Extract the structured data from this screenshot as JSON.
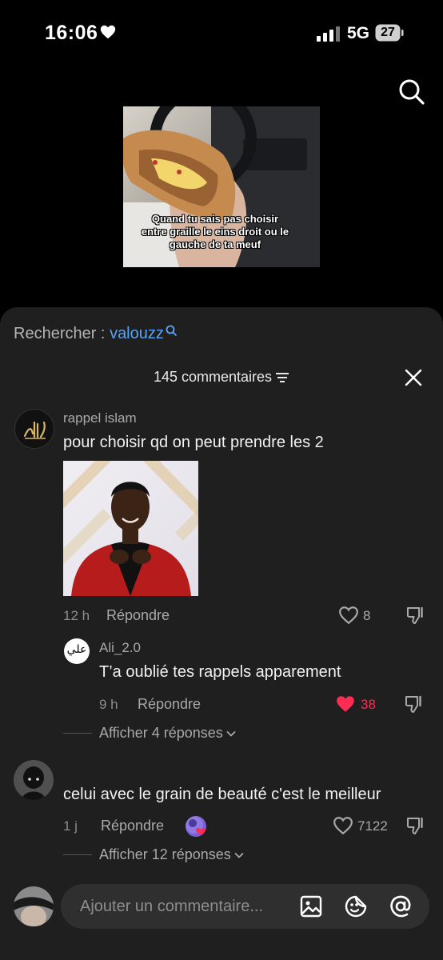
{
  "status": {
    "time": "16:06",
    "network": "5G",
    "battery": "27"
  },
  "video": {
    "caption": "Quand tu sais pas choisir entre graille le eins droit ou le gauche de ta meuf"
  },
  "search": {
    "label": "Rechercher : ",
    "term": "valouzz"
  },
  "header": {
    "comment_count": "145 commentaires"
  },
  "comments": [
    {
      "username": "rappel islam",
      "text": "pour choisir qd on peut prendre les 2",
      "time": "12 h",
      "reply_label": "Répondre",
      "likes": "8",
      "replies": [
        {
          "username": "Ali_2.0",
          "avatar_text": "علي",
          "text": "T’a oublié tes rappels apparement",
          "time": "9 h",
          "reply_label": "Répondre",
          "likes": "38",
          "liked": true
        }
      ],
      "more_replies": "Afficher 4 réponses"
    },
    {
      "username": "",
      "text": "celui avec le grain de beauté c'est le meilleur",
      "time": "1 j",
      "reply_label": "Répondre",
      "likes": "7122",
      "more_replies": "Afficher 12 réponses"
    }
  ],
  "input": {
    "placeholder": "Ajouter un commentaire..."
  },
  "colors": {
    "sheet_bg": "#1f1f1f",
    "accent_link": "#5aa3f5",
    "like_red": "#fe2c55"
  }
}
